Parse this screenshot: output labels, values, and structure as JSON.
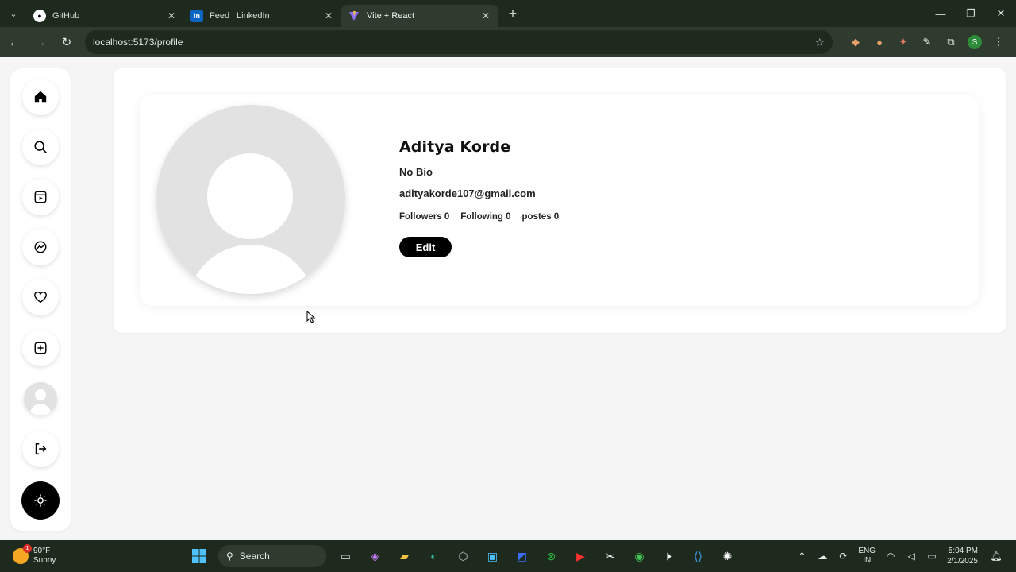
{
  "browser": {
    "tabs": [
      {
        "title": "GitHub",
        "icon": "github-icon"
      },
      {
        "title": "Feed | LinkedIn",
        "icon": "linkedin-icon"
      },
      {
        "title": "Vite + React",
        "icon": "vite-icon",
        "active": true
      }
    ],
    "url": "localhost:5173/profile",
    "profile_initial": "S"
  },
  "sidebar": {
    "items": [
      {
        "name": "home",
        "icon": "home-icon"
      },
      {
        "name": "search",
        "icon": "search-icon"
      },
      {
        "name": "reels",
        "icon": "reels-icon"
      },
      {
        "name": "messages",
        "icon": "messenger-icon"
      },
      {
        "name": "notifications",
        "icon": "heart-icon"
      },
      {
        "name": "create",
        "icon": "plus-square-icon"
      },
      {
        "name": "profile",
        "icon": "avatar"
      },
      {
        "name": "logout",
        "icon": "logout-icon"
      }
    ],
    "theme_toggle_icon": "sun-icon"
  },
  "profile": {
    "name": "Aditya Korde",
    "bio": "No Bio",
    "email": "adityakorde107@gmail.com",
    "followers_label": "Followers 0",
    "following_label": "Following 0",
    "posts_label": "postes 0",
    "edit_label": "Edit"
  },
  "taskbar": {
    "weather_temp": "90°F",
    "weather_desc": "Sunny",
    "weather_badge": "1",
    "search_label": "Search",
    "lang_1": "ENG",
    "lang_2": "IN",
    "time": "5:04 PM",
    "date": "2/1/2025"
  },
  "colors": {
    "page_bg": "#f5f5f5",
    "card_bg": "#ffffff",
    "button_black": "#000000",
    "avatar_grey": "#e2e2e2"
  }
}
